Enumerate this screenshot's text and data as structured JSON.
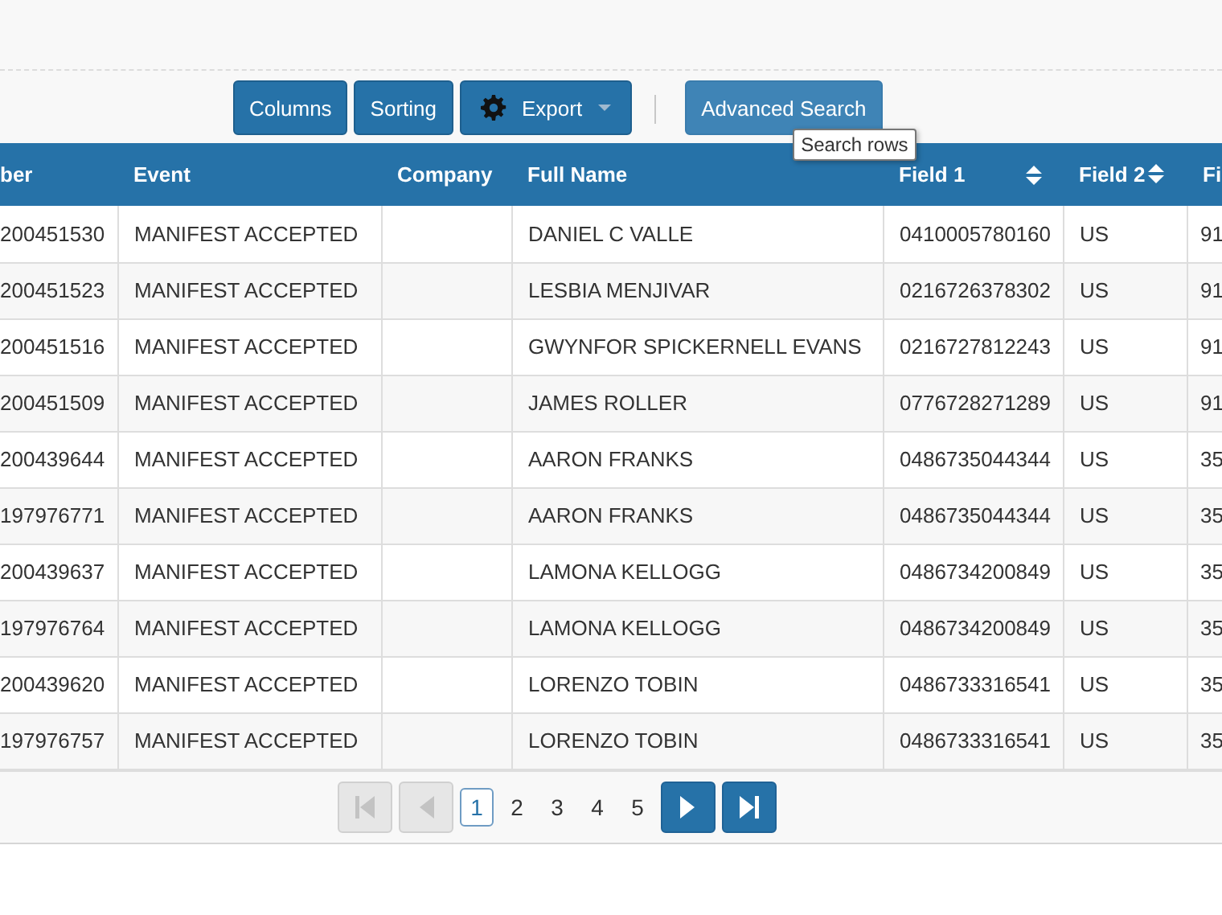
{
  "toolbar": {
    "buttons": [
      {
        "label": "Columns",
        "kind": "plain",
        "hovered": false
      },
      {
        "label": "Sorting",
        "kind": "plain",
        "hovered": false
      },
      {
        "label": "Export",
        "kind": "menu",
        "hovered": false
      },
      {
        "label": "Advanced Search",
        "kind": "plain",
        "hovered": true
      }
    ],
    "tooltip": "Search rows"
  },
  "table": {
    "columns": [
      {
        "label": "ber",
        "sortable": false
      },
      {
        "label": "Event",
        "sortable": false
      },
      {
        "label": "Company",
        "sortable": false
      },
      {
        "label": "Full Name",
        "sortable": false
      },
      {
        "label": "Field 1",
        "sortable": true
      },
      {
        "label": "Field 2",
        "sortable": true
      },
      {
        "label": "Fi"
      }
    ],
    "rows": [
      [
        "200451530",
        "MANIFEST ACCEPTED",
        "",
        "DANIEL C VALLE",
        "0410005780160",
        "US",
        "91"
      ],
      [
        "200451523",
        "MANIFEST ACCEPTED",
        "",
        "LESBIA MENJIVAR",
        "0216726378302",
        "US",
        "91"
      ],
      [
        "200451516",
        "MANIFEST ACCEPTED",
        "",
        "GWYNFOR SPICKERNELL EVANS",
        "0216727812243",
        "US",
        "91"
      ],
      [
        "200451509",
        "MANIFEST ACCEPTED",
        "",
        "JAMES ROLLER",
        "0776728271289",
        "US",
        "91"
      ],
      [
        "200439644",
        "MANIFEST ACCEPTED",
        "",
        "AARON FRANKS",
        "0486735044344",
        "US",
        "35"
      ],
      [
        "197976771",
        "MANIFEST ACCEPTED",
        "",
        "AARON FRANKS",
        "0486735044344",
        "US",
        "35"
      ],
      [
        "200439637",
        "MANIFEST ACCEPTED",
        "",
        "LAMONA KELLOGG",
        "0486734200849",
        "US",
        "35"
      ],
      [
        "197976764",
        "MANIFEST ACCEPTED",
        "",
        "LAMONA KELLOGG",
        "0486734200849",
        "US",
        "35"
      ],
      [
        "200439620",
        "MANIFEST ACCEPTED",
        "",
        "LORENZO TOBIN",
        "0486733316541",
        "US",
        "35"
      ],
      [
        "197976757",
        "MANIFEST ACCEPTED",
        "",
        "LORENZO TOBIN",
        "0486733316541",
        "US",
        "35"
      ]
    ]
  },
  "pagination": {
    "first_disabled": true,
    "prev_disabled": true,
    "next_disabled": false,
    "last_disabled": false,
    "pages": [
      {
        "label": "1",
        "selected": true
      },
      {
        "label": "2",
        "selected": false
      },
      {
        "label": "3",
        "selected": false
      },
      {
        "label": "4",
        "selected": false
      },
      {
        "label": "5",
        "selected": false
      }
    ]
  }
}
